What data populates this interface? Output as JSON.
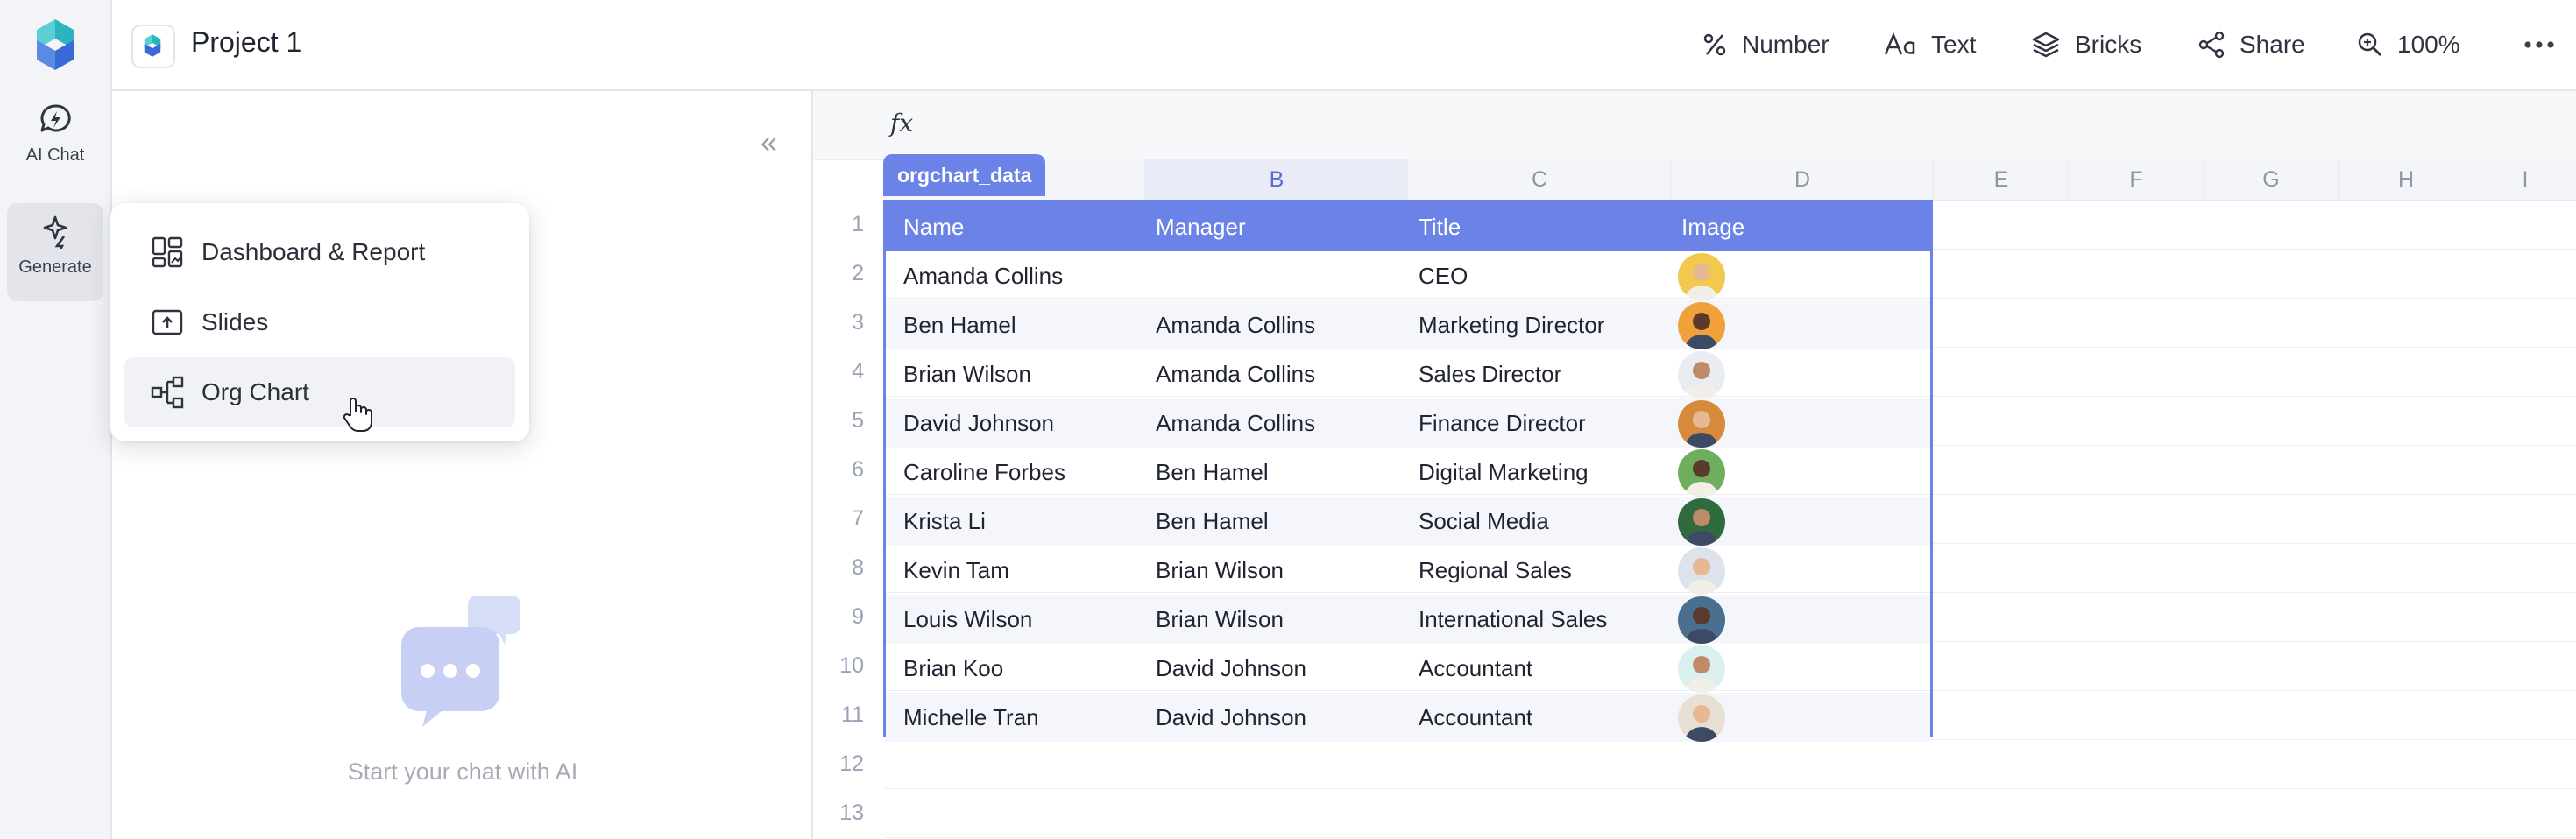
{
  "rail": {
    "items": [
      {
        "label": "AI Chat",
        "icon": "ai-chat-icon"
      },
      {
        "label": "Generate",
        "icon": "generate-sparkle-icon"
      }
    ]
  },
  "topbar": {
    "project_title": "Project 1",
    "tools": [
      {
        "label": "Number",
        "icon": "percent-icon"
      },
      {
        "label": "Text",
        "icon": "text-format-icon"
      },
      {
        "label": "Bricks",
        "icon": "layers-icon"
      },
      {
        "label": "Share",
        "icon": "share-icon"
      },
      {
        "label": "100%",
        "icon": "zoom-icon"
      }
    ],
    "more_icon": "more-horizontal-icon"
  },
  "panel": {
    "collapse_glyph": "«",
    "hint": "Start your chat with AI"
  },
  "menu": {
    "items": [
      {
        "label": "Dashboard & Report",
        "icon": "dashboard-icon"
      },
      {
        "label": "Slides",
        "icon": "slides-icon"
      },
      {
        "label": "Org Chart",
        "icon": "org-chart-icon",
        "hovered": true
      }
    ]
  },
  "sheet": {
    "fx_label": "fx",
    "table_name": "orgchart_data",
    "columns": [
      "B",
      "C",
      "D",
      "E",
      "F",
      "G",
      "H",
      "I"
    ],
    "selected_column": "B",
    "row_numbers": [
      "1",
      "2",
      "3",
      "4",
      "5",
      "6",
      "7",
      "8",
      "9",
      "10",
      "11",
      "12",
      "13"
    ],
    "headers": [
      "Name",
      "Manager",
      "Title",
      "Image"
    ],
    "rows": [
      {
        "name": "Amanda Collins",
        "manager": "",
        "title": "CEO"
      },
      {
        "name": "Ben Hamel",
        "manager": "Amanda Collins",
        "title": "Marketing Director"
      },
      {
        "name": "Brian Wilson",
        "manager": "Amanda Collins",
        "title": "Sales Director"
      },
      {
        "name": "David Johnson",
        "manager": "Amanda Collins",
        "title": "Finance Director"
      },
      {
        "name": "Caroline Forbes",
        "manager": "Ben Hamel",
        "title": "Digital Marketing"
      },
      {
        "name": "Krista Li",
        "manager": "Ben Hamel",
        "title": "Social Media"
      },
      {
        "name": "Kevin Tam",
        "manager": "Brian Wilson",
        "title": "Regional Sales"
      },
      {
        "name": "Louis Wilson",
        "manager": "Brian Wilson",
        "title": "International Sales"
      },
      {
        "name": "Brian Koo",
        "manager": "David Johnson",
        "title": "Accountant"
      },
      {
        "name": "Michelle Tran",
        "manager": "David Johnson",
        "title": "Accountant"
      }
    ],
    "avatar_colors": [
      "#f2c94c",
      "#f0a13a",
      "#e9edf2",
      "#d88a3c",
      "#6fae5c",
      "#2f6b3d",
      "#dde3ea",
      "#4a6f8f",
      "#d9f0ee",
      "#e8dfd4"
    ]
  },
  "colors": {
    "accent": "#6b82e6",
    "brand_teal": "#2bb3c0",
    "brand_blue": "#3a6ad6"
  }
}
